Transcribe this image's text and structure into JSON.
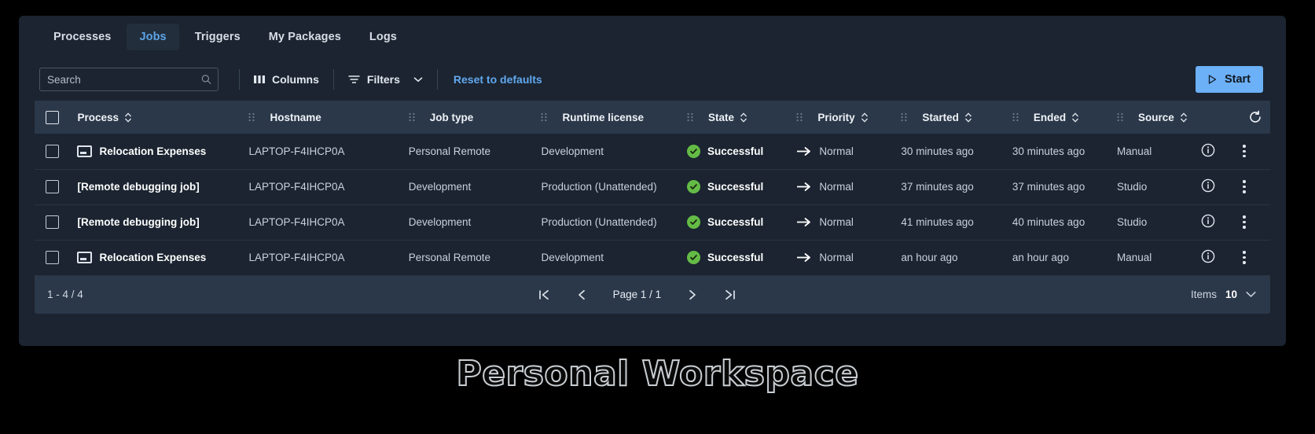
{
  "tabs": [
    {
      "label": "Processes",
      "active": false
    },
    {
      "label": "Jobs",
      "active": true
    },
    {
      "label": "Triggers",
      "active": false
    },
    {
      "label": "My Packages",
      "active": false
    },
    {
      "label": "Logs",
      "active": false
    }
  ],
  "toolbar": {
    "search_placeholder": "Search",
    "search_value": "",
    "columns_label": "Columns",
    "filters_label": "Filters",
    "reset_label": "Reset to defaults",
    "start_label": "Start",
    "accent_color": "#6cb0f7",
    "link_color": "#61a8ef"
  },
  "table": {
    "headers": [
      {
        "label": "Process",
        "sortable": true
      },
      {
        "label": "Hostname",
        "sortable": false
      },
      {
        "label": "Job type",
        "sortable": false
      },
      {
        "label": "Runtime license",
        "sortable": false
      },
      {
        "label": "State",
        "sortable": true
      },
      {
        "label": "Priority",
        "sortable": true
      },
      {
        "label": "Started",
        "sortable": true
      },
      {
        "label": "Ended",
        "sortable": true
      },
      {
        "label": "Source",
        "sortable": true
      }
    ],
    "rows": [
      {
        "process": "Relocation Expenses",
        "has_icon": true,
        "hostname": "LAPTOP-F4IHCP0A",
        "job_type": "Personal Remote",
        "runtime_license": "Development",
        "state": "Successful",
        "priority": "Normal",
        "started": "30 minutes ago",
        "ended": "30 minutes ago",
        "source": "Manual"
      },
      {
        "process": "[Remote debugging job]",
        "has_icon": false,
        "hostname": "LAPTOP-F4IHCP0A",
        "job_type": "Development",
        "runtime_license": "Production (Unattended)",
        "state": "Successful",
        "priority": "Normal",
        "started": "37 minutes ago",
        "ended": "37 minutes ago",
        "source": "Studio"
      },
      {
        "process": "[Remote debugging job]",
        "has_icon": false,
        "hostname": "LAPTOP-F4IHCP0A",
        "job_type": "Development",
        "runtime_license": "Production (Unattended)",
        "state": "Successful",
        "priority": "Normal",
        "started": "41 minutes ago",
        "ended": "40 minutes ago",
        "source": "Studio"
      },
      {
        "process": "Relocation Expenses",
        "has_icon": true,
        "hostname": "LAPTOP-F4IHCP0A",
        "job_type": "Personal Remote",
        "runtime_license": "Development",
        "state": "Successful",
        "priority": "Normal",
        "started": "an hour ago",
        "ended": "an hour ago",
        "source": "Manual"
      }
    ],
    "state_color": "#64bb46"
  },
  "footer": {
    "range": "1 - 4 / 4",
    "page_label": "Page 1 / 1",
    "items_label": "Items",
    "items_value": "10"
  },
  "caption": "Personal Workspace"
}
